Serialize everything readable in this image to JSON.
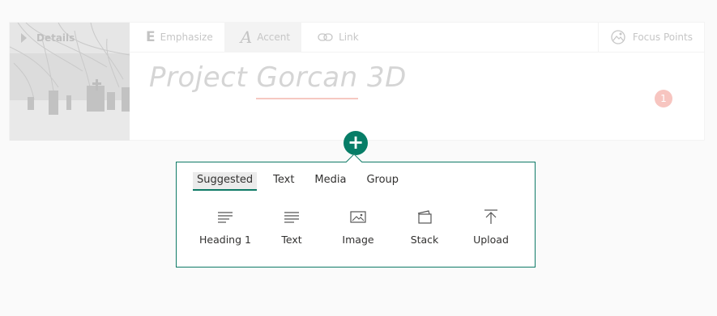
{
  "header": {
    "details_label": "Details",
    "toolbar": [
      {
        "name": "emphasize",
        "label": "Emphasize",
        "icon": "E"
      },
      {
        "name": "accent",
        "label": "Accent",
        "icon": "A"
      },
      {
        "name": "link",
        "label": "Link",
        "icon": "link-icon"
      }
    ],
    "focus_points_label": "Focus Points"
  },
  "title": {
    "part1": "Project ",
    "misspelled_word": "Gorcan",
    "part2": " 3D"
  },
  "error_count": "1",
  "add_button_symbol": "+",
  "picker": {
    "tabs": [
      "Suggested",
      "Text",
      "Media",
      "Group"
    ],
    "options": [
      {
        "label": "Heading 1",
        "icon": "heading-icon"
      },
      {
        "label": "Text",
        "icon": "text-icon"
      },
      {
        "label": "Image",
        "icon": "image-icon"
      },
      {
        "label": "Stack",
        "icon": "stack-icon"
      },
      {
        "label": "Upload",
        "icon": "upload-icon"
      }
    ]
  },
  "colors": {
    "accent": "#077d67",
    "error_badge": "#f7c5c0",
    "spell_underline": "#f6c8c1"
  }
}
